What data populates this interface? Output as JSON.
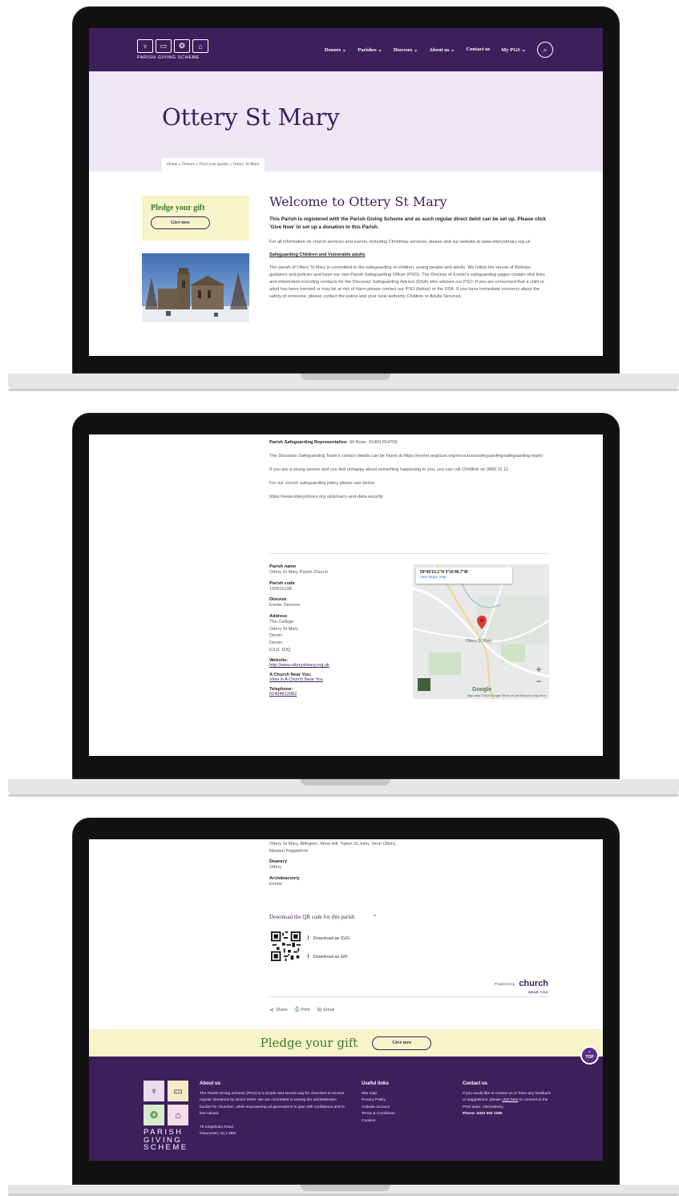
{
  "site": {
    "logo_text": "PARISH GIVING SCHEME",
    "nav": [
      "Donors ⌄",
      "Parishes ⌄",
      "Dioceses ⌄",
      "About us ⌄",
      "Contact us",
      "My PGS ⌄"
    ],
    "colors": {
      "brand_purple": "#3d1f5c",
      "hero_lilac": "#ede7f6",
      "pledge_yellow": "#f6f4c8",
      "pledge_green": "#3d7c2c"
    }
  },
  "hero": {
    "title": "Ottery St Mary",
    "breadcrumb": "Home » Donors » Find your parish » Ottery St Mary"
  },
  "sidebar": {
    "pledge_title": "Pledge your gift",
    "give_button": "Give now"
  },
  "main": {
    "welcome": "Welcome to Ottery St Mary",
    "lead": "This Parish is registered with the Parish Giving Scheme and as such regular direct debit can be set up. Please click 'Give Now' to set up a donation to this Parish.",
    "info": "For all information on church services and events, including Christmas services, please visit our website at www.otterystmary.org.uk",
    "safeguarding_heading": "Safeguarding Children and Vulnerable adults",
    "safeguarding_text": "The parish of Ottery St Mary is committed to the safeguarding of children, young people and adults. We follow the House of Bishops guidance and policies and have our own Parish Safeguarding Officer (PSO). The Diocese of Exeter's safeguarding pages contain vital links and information including contacts for the Diocesan Safeguarding Advisor (DSA) who advises our PSO. If you are concerned that a child or adult has been harmed or may be at risk of harm please contact our PSO (below) or the DSA. If you have immediate concerns about the safety of someone, please contact the police and your local authority Children or Adults Services.",
    "rep_label": "Parish Safeguarding Representative:",
    "rep_value": "Jill Rose, 01404 814709",
    "diocesan_team": "The Diocesan Safeguarding Team's contact details can be found at https://exeter.anglican.org/resources/safeguarding/safeguarding-team/",
    "childline": "If you are a young person and you feel unhappy about something happening to you, you can call Childline on 0800 11 11.",
    "policy_note": "For our church safeguarding policy please see below",
    "policy_url": "https://www.otterystmary.org.uk/privacy-and-data-security"
  },
  "details": {
    "parish_name_label": "Parish name",
    "parish_name": "Ottery St Mary Parish Church",
    "parish_code_label": "Parish code",
    "parish_code": "150615198",
    "diocese_label": "Diocese",
    "diocese": "Exeter Diocese",
    "address_label": "Address",
    "address": [
      "The College",
      "Ottery St Mary",
      "Devon",
      "Devon",
      "EX11 1DQ"
    ],
    "website_label": "Website:",
    "website": "http://www.otterystmary.org.uk",
    "cny_label": "A Church Near You:",
    "cny_link": "View in A Church Near You",
    "telephone_label": "Telephone:",
    "telephone": "01404812062",
    "benefice_text": "Ottery St Mary, Alfington, West Hill, Tipton St John, Venn Ottery, Newton Poppleford",
    "deanery_label": "Deanery",
    "deanery": "Ottery",
    "archdeaconry_label": "Archdeaconry",
    "archdeaconry": "Exeter"
  },
  "map": {
    "coords": "50°45'10.1\"N 3°16'46.7\"W",
    "view_larger": "View larger map",
    "place_label": "Ottery St Mary",
    "google": "Google",
    "footer": "Map data ©2020 Google   Terms of Use   Report a map error",
    "zoom_in": "+",
    "zoom_out": "−"
  },
  "qr": {
    "toggle_label": "Download the QR code for this parish",
    "toggle_icon": "chevron-up-icon",
    "svg_link": "Download as SVG",
    "gif_link": "Download as GIF"
  },
  "powered": {
    "label": "Powered by",
    "logo": "church",
    "logo_sub": "NEAR YOU"
  },
  "share": {
    "share": "Share",
    "print": "Print",
    "email": "Email"
  },
  "band": {
    "title": "Pledge your gift",
    "button": "Give now",
    "top_button": "TOP"
  },
  "footer": {
    "logo_lines": [
      "PARISH",
      "GIVING",
      "SCHEME"
    ],
    "about_head": "About us",
    "about_text": "The Parish Giving Scheme (PGS) is a simple and secure way for churches to receive regular donations by Direct Debit. We are committed to easing the administrative burden for churches, while empowering all generations to give with confidence and to feel valued.",
    "address_lines": [
      "76 Kingsholm Road",
      "Gloucester, GL1 3BD"
    ],
    "links_head": "Useful links",
    "links": [
      "Site map",
      "Privacy Policy",
      "Activate account",
      "Terms & Conditions",
      "Cookies"
    ],
    "contact_head": "Contact us",
    "contact_text": "If you would like to contact us or have any feedback or suggestions, please",
    "contact_link": "click here",
    "contact_text2": "to connect to the PGS team. Alternatively,",
    "phone": "Phone: 0333 002 1260"
  }
}
